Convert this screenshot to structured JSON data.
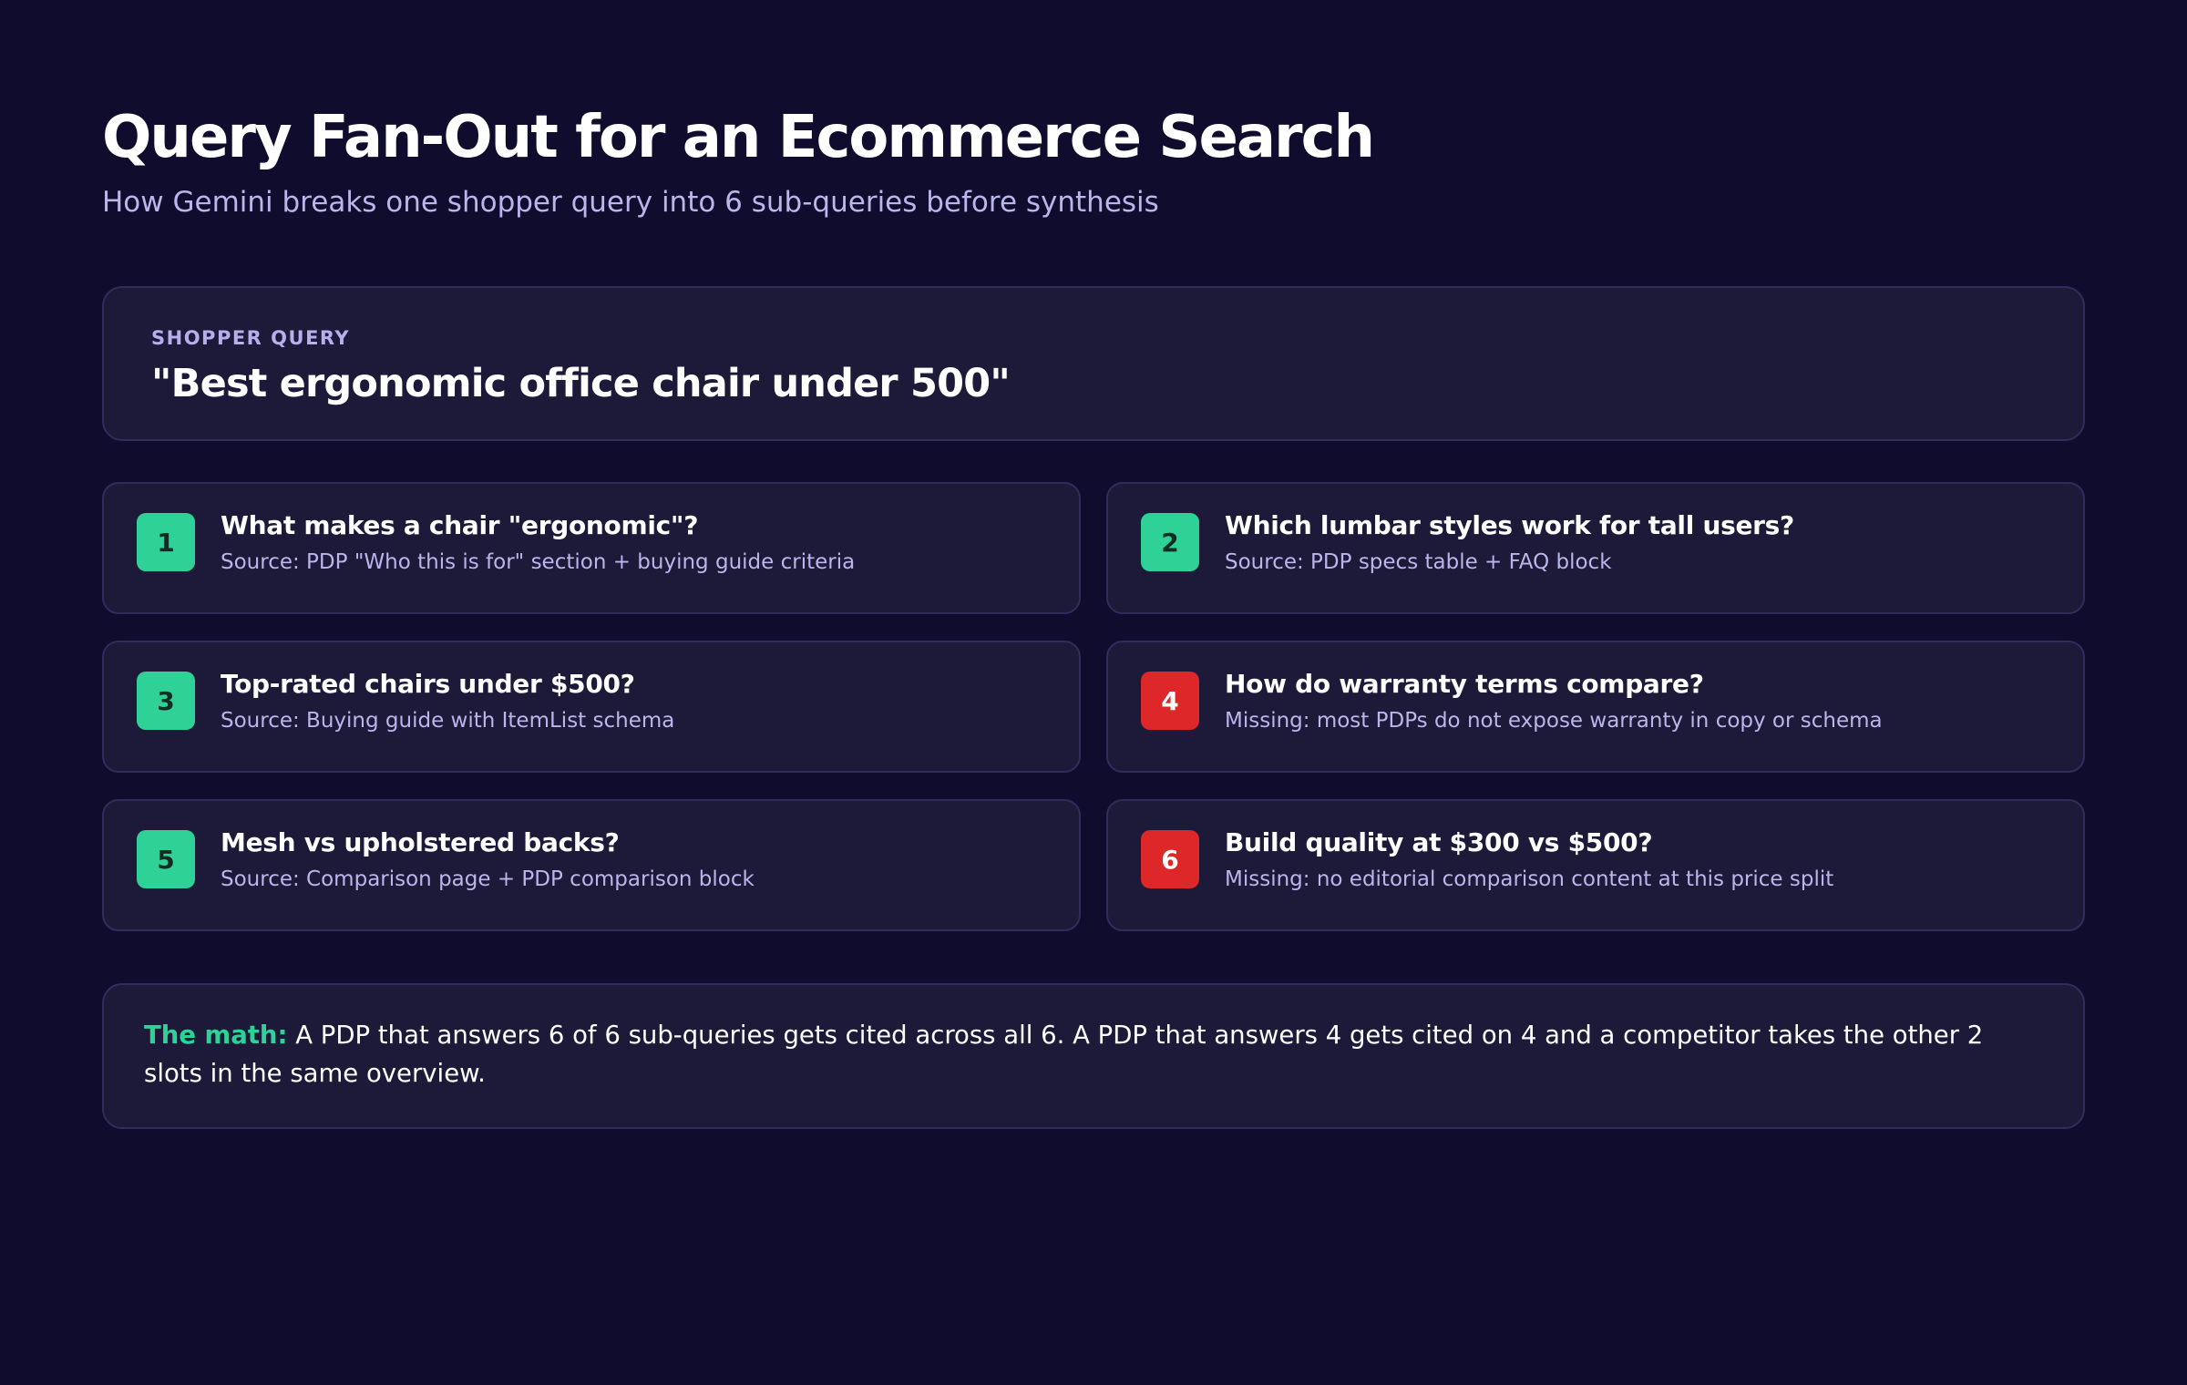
{
  "header": {
    "title": "Query Fan-Out for an Ecommerce Search",
    "subtitle": "How Gemini breaks one shopper query into 6 sub-queries before synthesis"
  },
  "query": {
    "kicker": "SHOPPER QUERY",
    "text": "\"Best ergonomic office chair under 500\""
  },
  "subqueries": [
    {
      "number": "1",
      "status": "covered",
      "question": "What makes a chair \"ergonomic\"?",
      "detail": "Source: PDP \"Who this is for\" section + buying guide criteria"
    },
    {
      "number": "2",
      "status": "covered",
      "question": "Which lumbar styles work for tall users?",
      "detail": "Source: PDP specs table + FAQ block"
    },
    {
      "number": "3",
      "status": "covered",
      "question": "Top-rated chairs under $500?",
      "detail": "Source: Buying guide with ItemList schema"
    },
    {
      "number": "4",
      "status": "missing",
      "question": "How do warranty terms compare?",
      "detail": "Missing: most PDPs do not expose warranty in copy or schema"
    },
    {
      "number": "5",
      "status": "covered",
      "question": "Mesh vs upholstered backs?",
      "detail": "Source: Comparison page + PDP comparison block"
    },
    {
      "number": "6",
      "status": "missing",
      "question": "Build quality at $300 vs $500?",
      "detail": "Missing: no editorial comparison content at this price split"
    }
  ],
  "math": {
    "label": "The math:",
    "text": " A PDP that answers 6 of 6 sub-queries gets cited across all 6. A PDP that answers 4 gets cited on 4 and a competitor takes the other 2 slots in the same overview."
  },
  "colors": {
    "background": "#100c2d",
    "card": "#1d1939",
    "covered_badge": "#2ed297",
    "missing_badge": "#de2728",
    "accent_text": "#2ed297",
    "muted_text": "#b9b6ec"
  }
}
